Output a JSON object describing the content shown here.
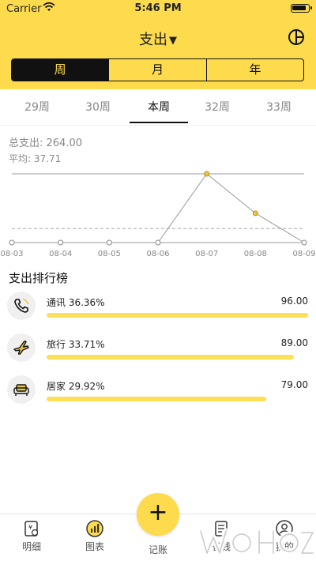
{
  "status": {
    "carrier": "Carrier",
    "time": "5:46 PM"
  },
  "header": {
    "title": "支出",
    "title_arrow": "▼",
    "icon": "pie-chart-icon"
  },
  "segments": [
    {
      "label": "周",
      "active": true
    },
    {
      "label": "月",
      "active": false
    },
    {
      "label": "年",
      "active": false
    }
  ],
  "weeks": [
    {
      "label": "29周",
      "active": false
    },
    {
      "label": "30周",
      "active": false
    },
    {
      "label": "本周",
      "active": true
    },
    {
      "label": "32周",
      "active": false
    },
    {
      "label": "33周",
      "active": false
    }
  ],
  "summary": {
    "total": "总支出: 264.00",
    "average": "平均: 37.71"
  },
  "chart_data": {
    "type": "line",
    "categories": [
      "08-03",
      "08-04",
      "08-05",
      "08-06",
      "08-07",
      "08-08",
      "08-09"
    ],
    "values": [
      0,
      0,
      0,
      0,
      185,
      79,
      0
    ],
    "average_line": 37.71,
    "ylim": [
      0,
      185
    ],
    "grid": false,
    "color": "#e8c73d"
  },
  "ranking": {
    "title": "支出排行榜",
    "items": [
      {
        "name": "通讯 36.36%",
        "amount": "96.00",
        "share": 1.0,
        "icon": "phone-icon"
      },
      {
        "name": "旅行 33.71%",
        "amount": "89.00",
        "share": 0.945,
        "icon": "airplane-icon"
      },
      {
        "name": "居家 29.92%",
        "amount": "79.00",
        "share": 0.84,
        "icon": "sofa-icon"
      }
    ]
  },
  "tabs": [
    {
      "label": "明细",
      "icon": "ledger-icon"
    },
    {
      "label": "图表",
      "icon": "chart-icon"
    },
    {
      "label": "记账",
      "icon": "plus-icon"
    },
    {
      "label": "省钱",
      "icon": "document-icon"
    },
    {
      "label": "我的",
      "icon": "user-icon"
    }
  ],
  "colors": {
    "accent": "#fddb4c",
    "bar": "#fde055",
    "text": "#222222"
  }
}
